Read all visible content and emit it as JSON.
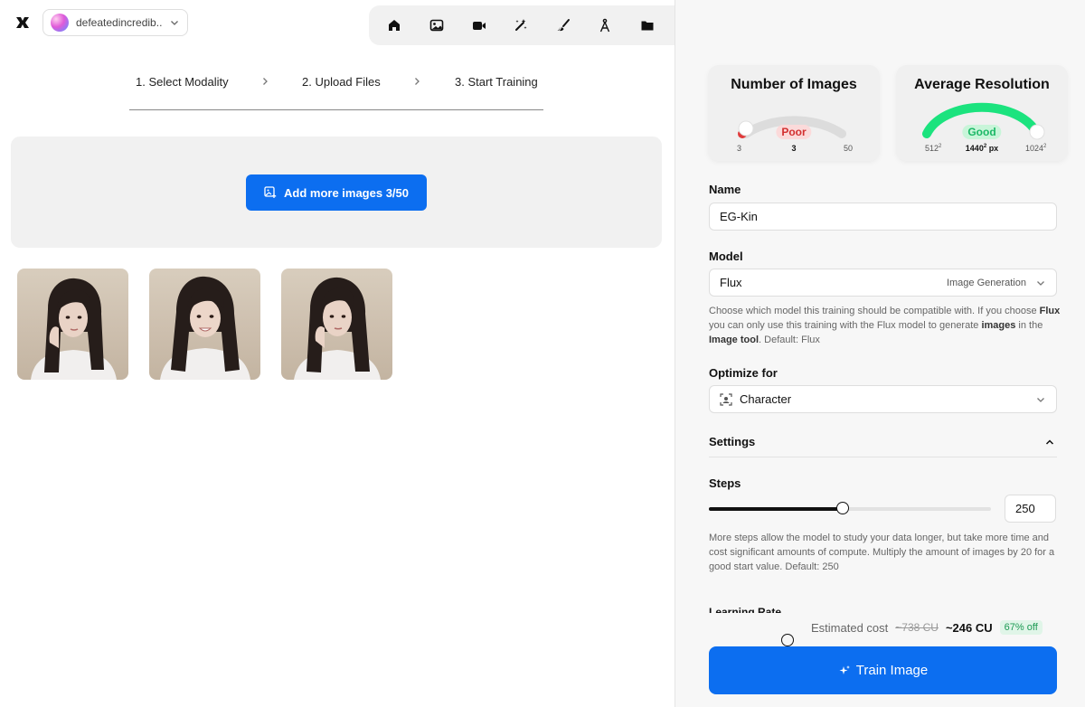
{
  "workspace": {
    "name": "defeatedincredib..."
  },
  "toolbar": {
    "icons": [
      "home-icon",
      "image-icon",
      "video-icon",
      "magic-wand-icon",
      "brush-icon",
      "compass-icon",
      "folder-icon",
      "chip-icon"
    ],
    "active": "chip-icon"
  },
  "steps": {
    "step1": "1. Select Modality",
    "step2": "2. Upload Files",
    "step3": "3. Start Training"
  },
  "upload": {
    "button_label": "Add more images 3/50",
    "images": [
      {
        "alt": "training-image-1"
      },
      {
        "alt": "training-image-2"
      },
      {
        "alt": "training-image-3"
      }
    ]
  },
  "metrics": {
    "images": {
      "title": "Number of Images",
      "status": "Poor",
      "min": "3",
      "value": "3",
      "max": "50",
      "level": 0.0
    },
    "resolution": {
      "title": "Average Resolution",
      "status": "Good",
      "min_base": "512",
      "value_base": "1440",
      "value_unit": "px",
      "max_base": "1024",
      "sup": "2",
      "level": 1.0
    }
  },
  "form": {
    "name_label": "Name",
    "name_value": "EG-Kin",
    "model_label": "Model",
    "model_value": "Flux",
    "model_category": "Image Generation",
    "model_help_1": "Choose which model this training should be compatible with. If you choose ",
    "model_help_bold1": "Flux",
    "model_help_2": " you can only use this training with the Flux model to generate ",
    "model_help_bold2": "images",
    "model_help_3": " in the ",
    "model_help_bold3": "Image tool",
    "model_help_4": ". Default: Flux",
    "optimize_label": "Optimize for",
    "optimize_value": "Character",
    "settings_label": "Settings",
    "steps_label": "Steps",
    "steps_value": "250",
    "steps_fraction": 0.475,
    "steps_help": "More steps allow the model to study your data longer, but take more time and cost significant amounts of compute. Multiply the amount of images by 20 for a good start value. Default: 250",
    "learning_rate_label": "Learning Rate"
  },
  "cost": {
    "label": "Estimated cost",
    "old": "~738 CU",
    "new": "~246 CU",
    "badge": "67% off"
  },
  "train": {
    "label": "Train Image"
  },
  "colors": {
    "accent": "#0c6ef0",
    "good": "#1be37e",
    "poor": "#e03b3b"
  }
}
